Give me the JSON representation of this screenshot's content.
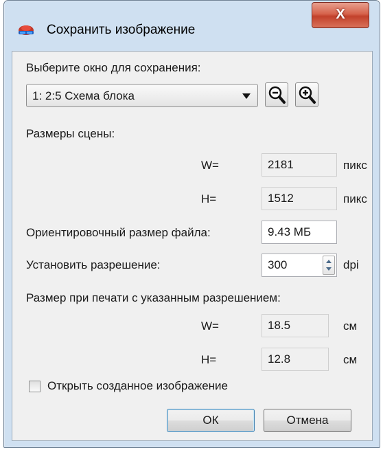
{
  "window": {
    "title": "Сохранить изображение",
    "close_label": "X"
  },
  "select_window": {
    "label": "Выберите окно для сохранения:",
    "value": "1: 2:5 Схема блока"
  },
  "scene_size": {
    "label": "Размеры сцены:",
    "w_label": "W=",
    "w_value": "2181",
    "h_label": "H=",
    "h_value": "1512",
    "unit": "пикс"
  },
  "file_size": {
    "label": "Ориентировочный размер файла:",
    "value": "9.43 МБ"
  },
  "resolution": {
    "label": "Установить разрешение:",
    "value": "300",
    "unit": "dpi"
  },
  "print_size": {
    "label": "Размер при печати с указанным разрешением:",
    "w_label": "W=",
    "w_value": "18.5",
    "h_label": "H=",
    "h_value": "12.8",
    "unit": "см"
  },
  "open_checkbox": {
    "label": "Открыть созданное изображение",
    "checked": false
  },
  "buttons": {
    "ok": "ОК",
    "cancel": "Отмена"
  }
}
